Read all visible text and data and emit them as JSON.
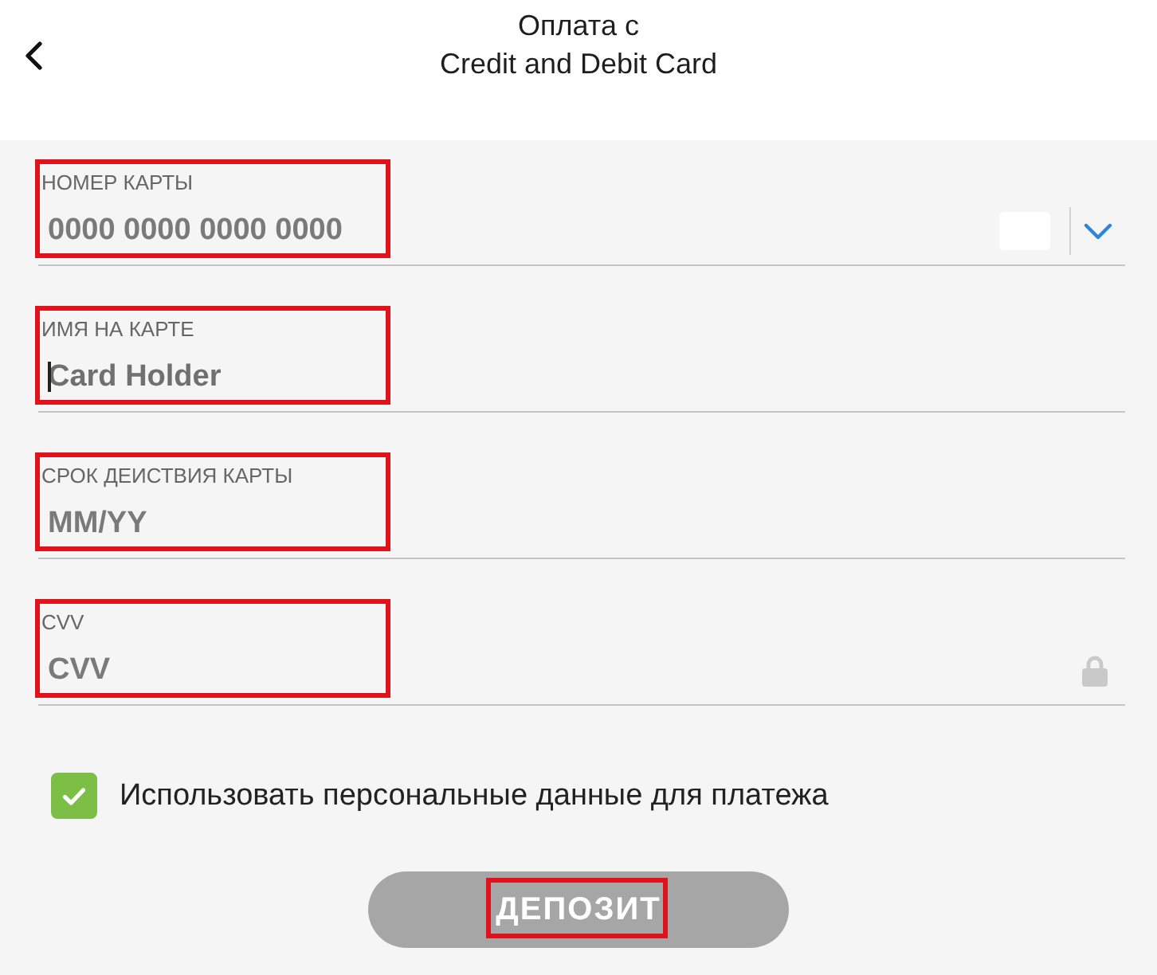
{
  "header": {
    "title": "Оплата с",
    "subtitle": "Credit and Debit Card"
  },
  "fields": [
    {
      "kind": "card",
      "label": "НОМЕР КАРТЫ",
      "placeholder": "0000 0000 0000 0000",
      "focused": false,
      "highlighted": true
    },
    {
      "kind": "plain",
      "label": "ИМЯ НА КАРТЕ",
      "placeholder": "Card Holder",
      "focused": true,
      "highlighted": true
    },
    {
      "kind": "plain",
      "label": "СРОК ДЕИСТВИЯ КАРТЫ",
      "placeholder": "MM/YY",
      "focused": false,
      "highlighted": true
    },
    {
      "kind": "secure",
      "label": "CVV",
      "placeholder": "CVV",
      "focused": false,
      "highlighted": true
    }
  ],
  "consent": {
    "label": "Использовать персональные данные для платежа",
    "checked": true
  },
  "submit": {
    "label": "ДЕПОЗИТ",
    "disabled": true,
    "highlighted": true
  }
}
